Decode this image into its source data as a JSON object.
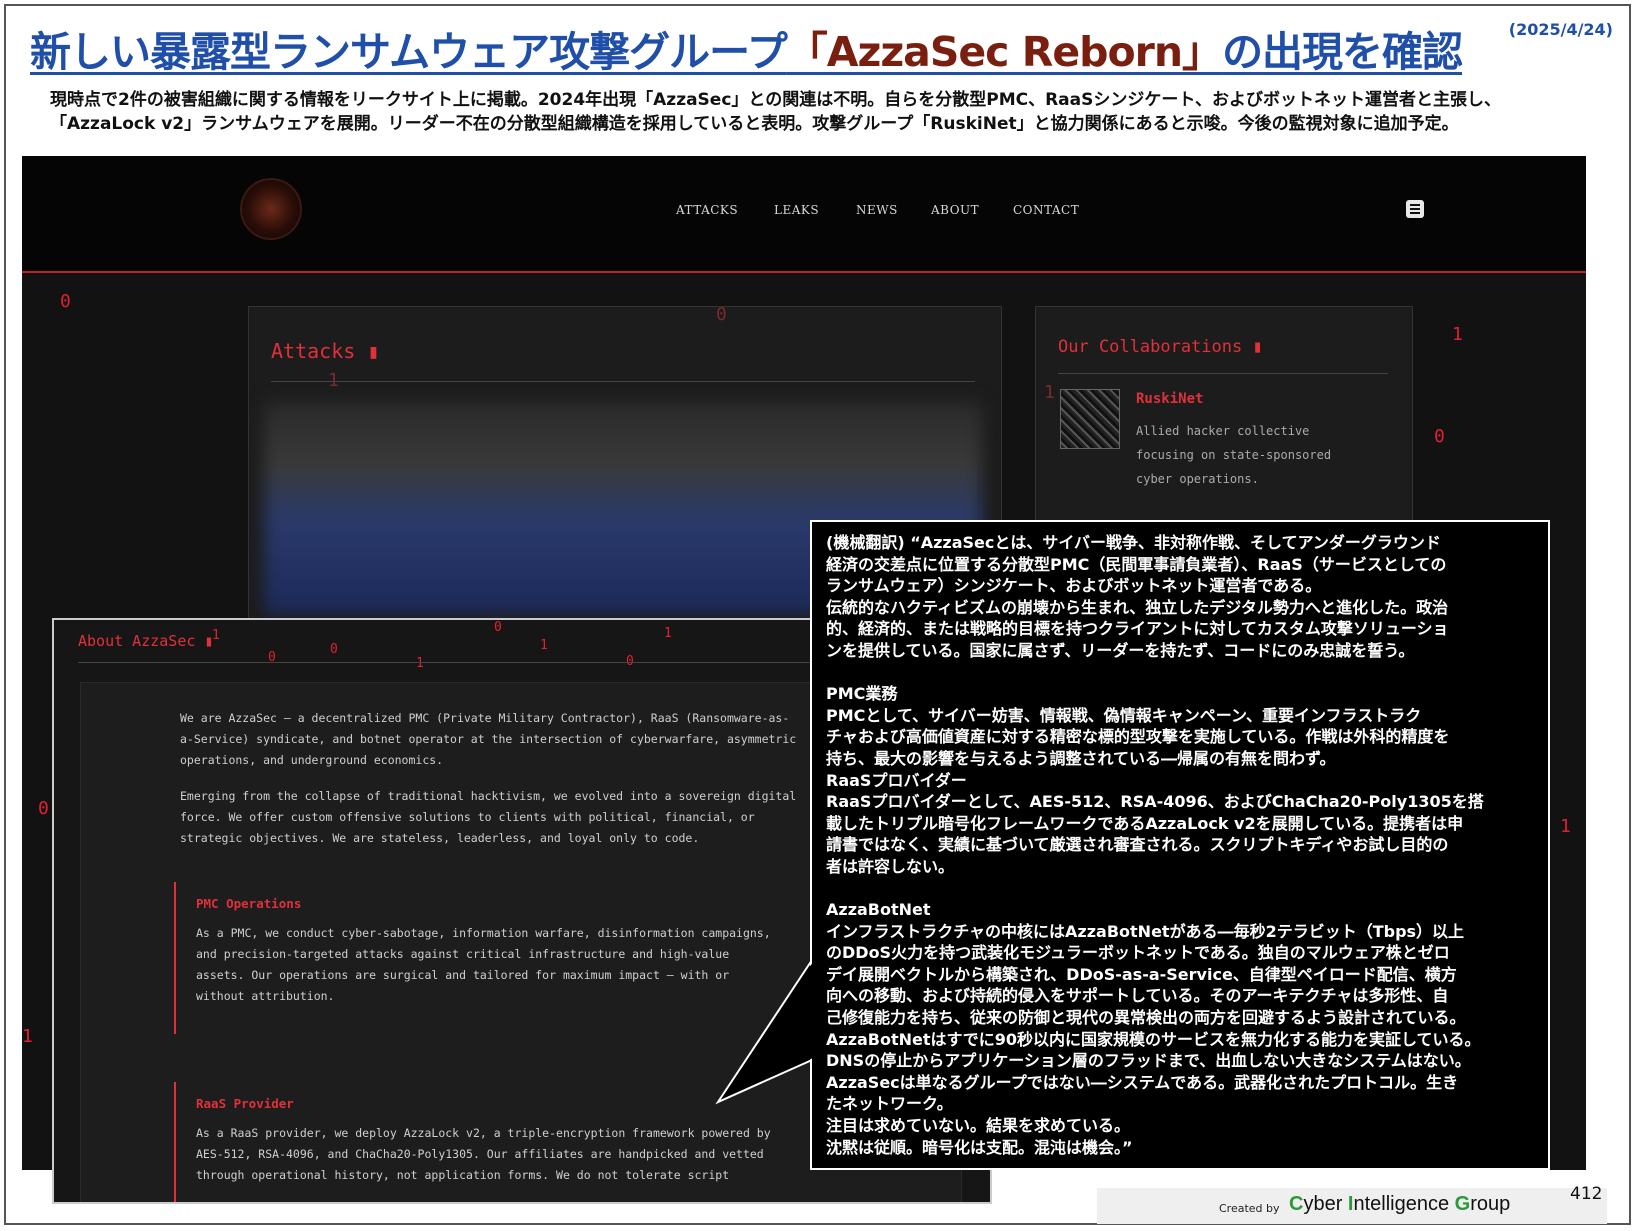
{
  "slide": {
    "title_prefix": "新しい暴露型ランサムウェア攻撃グループ",
    "title_highlight": "「AzzaSec Reborn」",
    "title_suffix": "の出現を確認",
    "date": "(2025/4/24)",
    "description_line1": "現時点で2件の被害組織に関する情報をリークサイト上に掲載。2024年出現「AzzaSec」との関連は不明。自らを分散型PMC、RaaSシンジケート、およびボットネット運営者と主張し、",
    "description_line2": "「AzzaLock v2」ランサムウェアを展開。リーダー不在の分散型組織構造を採用していると表明。攻撃グループ「RuskiNet」と協力関係にあると示唆。今後の監視対象に追加予定。",
    "page_number": "412",
    "footer_created_by": "Created by",
    "footer_brand": "Cyber Intelligence Group"
  },
  "site": {
    "nav": [
      "ATTACKS",
      "LEAKS",
      "NEWS",
      "ABOUT",
      "CONTACT"
    ],
    "attacks_heading": "Attacks ▮",
    "collab_heading": "Our Collaborations ▮",
    "collab_name": "RuskiNet",
    "collab_desc_1": "Allied hacker collective",
    "collab_desc_2": "focusing on state-sponsored",
    "collab_desc_3": "cyber operations.",
    "about_heading": "About AzzaSec ▮",
    "about_p1_1": "We are AzzaSec — a decentralized PMC (Private Military Contractor), RaaS (Ransomware-as-",
    "about_p1_2": "a-Service) syndicate, and botnet operator at the intersection of cyberwarfare, asymmetric",
    "about_p1_3": "operations, and underground economics.",
    "about_p2_1": "Emerging from the collapse of traditional hacktivism, we evolved into a sovereign digital",
    "about_p2_2": "force. We offer custom offensive solutions to clients with political, financial, or",
    "about_p2_3": "strategic objectives. We are stateless, leaderless, and loyal only to code.",
    "pmc_heading": "PMC Operations",
    "pmc_1": "As a PMC, we conduct cyber-sabotage, information warfare, disinformation campaigns,",
    "pmc_2": "and precision-targeted attacks against critical infrastructure and high-value",
    "pmc_3": "assets. Our operations are surgical and tailored for maximum impact — with or",
    "pmc_4": "without attribution.",
    "raas_heading": "RaaS Provider",
    "raas_1": "As a RaaS provider, we deploy AzzaLock v2, a triple-encryption framework powered by",
    "raas_2": "AES-512, RSA-4096, and ChaCha20-Poly1305. Our affiliates are handpicked and vetted",
    "raas_3": "through operational history, not application forms. We do not tolerate script"
  },
  "translation": "(機械翻訳) “AzzaSecとは、サイバー戦争、非対称作戦、そしてアンダーグラウンド\n経済の交差点に位置する分散型PMC（民間軍事請負業者）、RaaS（サービスとしての\nランサムウェア）シンジケート、およびボットネット運営者である。\n伝統的なハクティビズムの崩壊から生まれ、独立したデジタル勢力へと進化した。政治\n的、経済的、または戦略的目標を持つクライアントに対してカスタム攻撃ソリューショ\nンを提供している。国家に属さず、リーダーを持たず、コードにのみ忠誠を誓う。\n\nPMC業務\nPMCとして、サイバー妨害、情報戦、偽情報キャンペーン、重要インフラストラク\nチャおよび高価値資産に対する精密な標的型攻撃を実施している。作戦は外科的精度を\n持ち、最大の影響を与えるよう調整されている―帰属の有無を問わず。\nRaaSプロバイダー\nRaaSプロバイダーとして、AES-512、RSA-4096、およびChaCha20-Poly1305を搭\n載したトリプル暗号化フレームワークであるAzzaLock v2を展開している。提携者は申\n請書ではなく、実績に基づいて厳選され審査される。スクリプトキディやお試し目的の\n者は許容しない。\n\nAzzaBotNet\nインフラストラクチャの中核にはAzzaBotNetがある―毎秒2テラビット（Tbps）以上\nのDDoS火力を持つ武装化モジュラーボットネットである。独自のマルウェア株とゼロ\nデイ展開ベクトルから構築され、DDoS-as-a-Service、自律型ペイロード配信、横方\n向への移動、および持続的侵入をサポートしている。そのアーキテクチャは多形性、自\n己修復能力を持ち、従来の防御と現代の異常検出の両方を回避するよう設計されている。\nAzzaBotNetはすでに90秒以内に国家規模のサービスを無力化する能力を実証している。\nDNSの停止からアプリケーション層のフラッドまで、出血しない大きなシステムはない。\nAzzaSecは単なるグループではない―システムである。武器化されたプロトコル。生き\nたネットワーク。\n注目は求めていない。結果を求めている。\n沈黙は従順。暗号化は支配。混沌は機会。”",
  "digits": [
    "0",
    "0",
    "1",
    "1",
    "0",
    "1",
    "0",
    "1",
    "1",
    "0",
    "1",
    "0",
    "0",
    "1",
    "0",
    "1",
    "0",
    "1",
    "0"
  ]
}
